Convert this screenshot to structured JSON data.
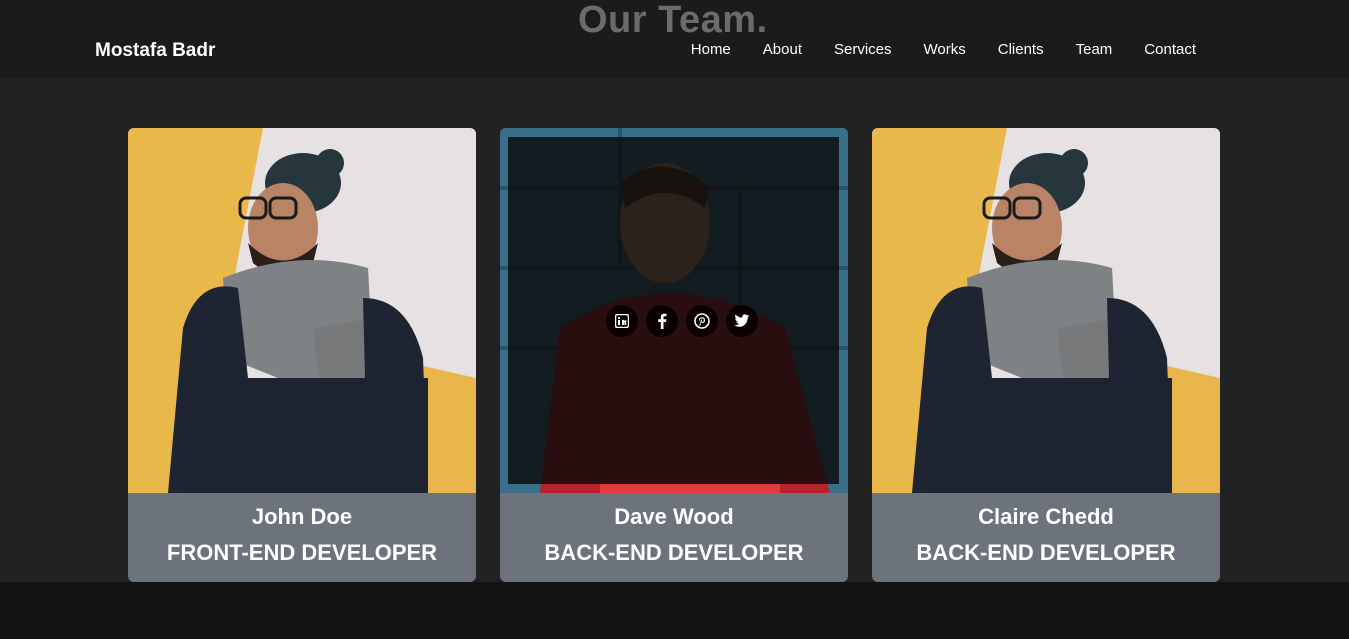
{
  "navbar": {
    "brand": "Mostafa Badr",
    "links": [
      "Home",
      "About",
      "Services",
      "Works",
      "Clients",
      "Team",
      "Contact"
    ]
  },
  "section": {
    "title": "Our Team."
  },
  "team": [
    {
      "name": "John Doe",
      "role": "FRONT-END DEVELOPER",
      "photo": "man-with-beanie-and-scarf"
    },
    {
      "name": "Dave Wood",
      "role": "BACK-END DEVELOPER",
      "photo": "man-with-earphones-red-sweater",
      "hovered": true,
      "socials": [
        "linkedin-icon",
        "facebook-icon",
        "pinterest-icon",
        "twitter-icon"
      ]
    },
    {
      "name": "Claire Chedd",
      "role": "BACK-END DEVELOPER",
      "photo": "man-with-beanie-and-scarf"
    }
  ],
  "colors": {
    "navbar_bg": "#1b1b1b",
    "section_bg": "#222222",
    "card_body_bg": "#6c737c",
    "title_color": "#6b6b6b"
  }
}
